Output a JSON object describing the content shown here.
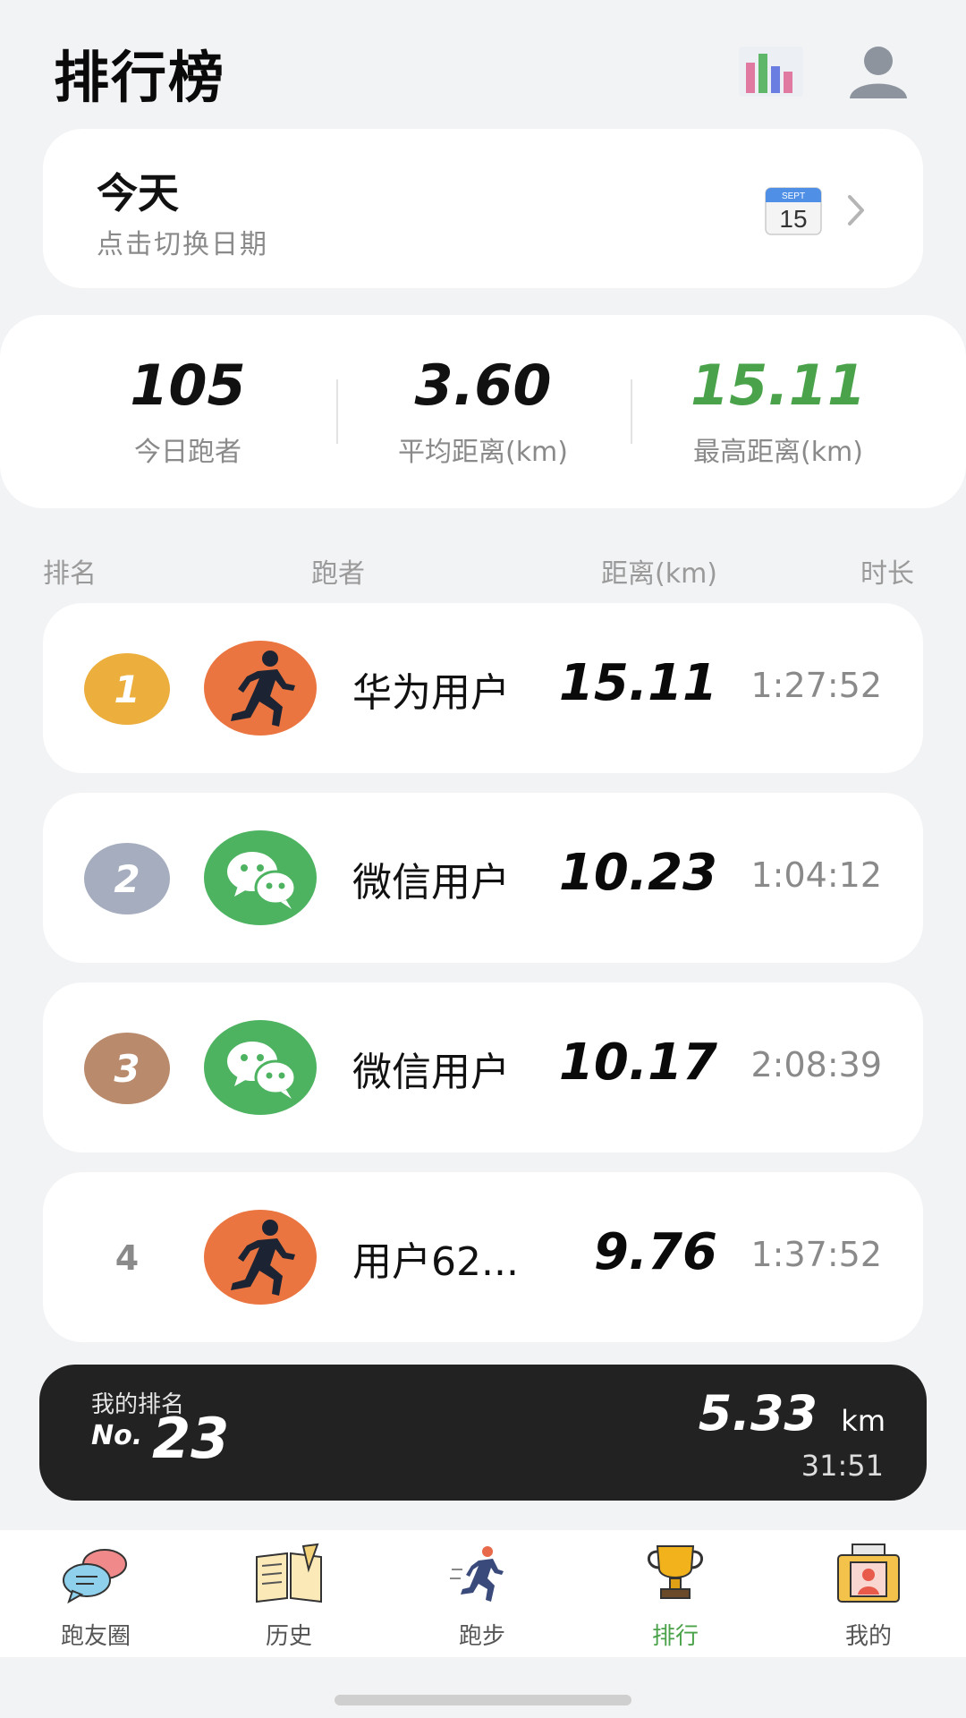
{
  "header": {
    "title": "排行榜"
  },
  "date_selector": {
    "title": "今天",
    "hint": "点击切换日期",
    "calendar_month": "SEPT",
    "calendar_day": "15"
  },
  "stats": [
    {
      "value": "105",
      "label": "今日跑者"
    },
    {
      "value": "3.60",
      "label": "平均距离(km)"
    },
    {
      "value": "15.11",
      "label": "最高距离(km)",
      "color": "#4aa34a"
    }
  ],
  "columns": {
    "rank": "排名",
    "runner": "跑者",
    "distance": "距离(km)",
    "duration": "时长"
  },
  "rows": [
    {
      "rank": "1",
      "avatar": "runner-icon",
      "name": "华为用户",
      "distance": "15.11",
      "duration": "1:27:52",
      "badge_color": "#ecae3c"
    },
    {
      "rank": "2",
      "avatar": "wechat-icon",
      "name": "微信用户",
      "distance": "10.23",
      "duration": "1:04:12",
      "badge_color": "#a6adbf"
    },
    {
      "rank": "3",
      "avatar": "wechat-icon",
      "name": "微信用户",
      "distance": "10.17",
      "duration": "2:08:39",
      "badge_color": "#b98a6c"
    },
    {
      "rank": "4",
      "avatar": "runner-icon",
      "name": "用户62...",
      "distance": "9.76",
      "duration": "1:37:52"
    }
  ],
  "my_rank": {
    "label": "我的排名",
    "prefix": "No.",
    "rank": "23",
    "distance": "5.33",
    "unit": "km",
    "duration": "31:51"
  },
  "tabs": [
    {
      "label": "跑友圈",
      "icon": "chat-bubbles-icon"
    },
    {
      "label": "历史",
      "icon": "book-icon"
    },
    {
      "label": "跑步",
      "icon": "running-man-icon"
    },
    {
      "label": "排行",
      "icon": "trophy-icon",
      "active": true
    },
    {
      "label": "我的",
      "icon": "profile-card-icon"
    }
  ],
  "colors": {
    "accent_green": "#4aa34a",
    "avatar_orange": "#ea7540",
    "avatar_green": "#4db361",
    "my_rank_bg": "#222222"
  }
}
